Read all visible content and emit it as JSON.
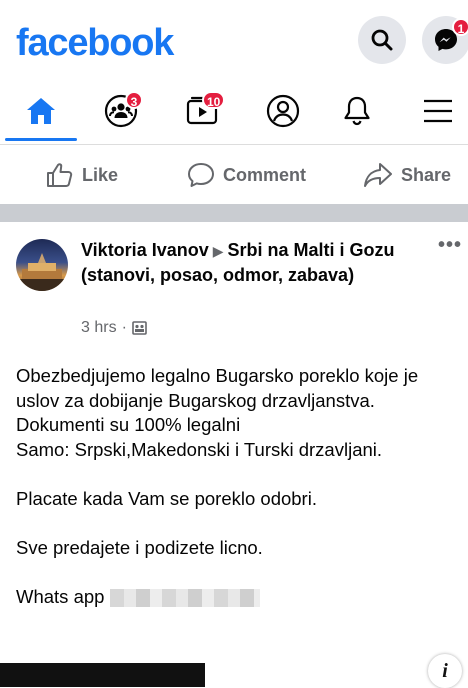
{
  "header": {
    "logo": "facebook",
    "messenger_badge": "1"
  },
  "nav": {
    "friends_badge": "3",
    "watch_badge": "10"
  },
  "actions": {
    "like": "Like",
    "comment": "Comment",
    "share": "Share"
  },
  "post": {
    "author": "Viktoria Ivanov",
    "group": "Srbi na Malti i Gozu (stanovi, posao, odmor, zabava)",
    "time": "3 hrs",
    "more": "•••",
    "lines": [
      "Obezbedjujemo legalno Bugarsko poreklo koje je uslov za dobijanje Bugarskog drzavljanstva.",
      "Dokumenti su 100% legalni",
      "Samo: Srpski,Makedonski i Turski drzavljani."
    ],
    "para2": "Placate kada Vam se poreklo odobri.",
    "para3": "Sve predajete i podizete licno.",
    "whatsapp_label": "Whats app"
  },
  "info_glyph": "i",
  "colors": {
    "brand": "#1877f2",
    "badge": "#e41e3f",
    "secondary_text": "#65676b"
  }
}
